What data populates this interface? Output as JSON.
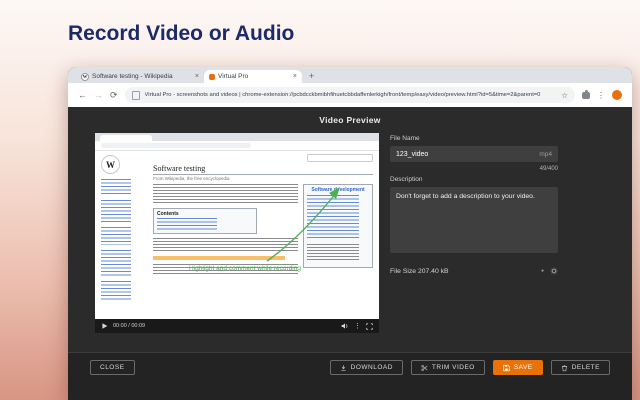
{
  "hero": {
    "title": "Record Video or Audio"
  },
  "browser": {
    "tab1": "Software testing - Wikipedia",
    "tab2": "Virtual Pro",
    "url": "Virtual Pro - screenshots and videos | chrome-extension://pcbdcckbmibhfihuetcbbdaffenlerkigh/front/temp/easy/video/preview.html?id=5&time=2&parent=0"
  },
  "preview": {
    "heading": "Video Preview",
    "annotation": "Highlight and comment while recording",
    "time": "00:00 / 00:09"
  },
  "wiki": {
    "logo_letter": "W",
    "title": "Software testing",
    "subtitle": "From Wikipedia, the free encyclopedia",
    "contents": "Contents",
    "infobox_title": "Software development"
  },
  "panel": {
    "file_name_label": "File Name",
    "file_name_value": "123_video",
    "file_ext": "mp4",
    "char_counter": "49/400",
    "description_label": "Description",
    "description_value": "Don't forget to add a description to your video.",
    "file_size": "File Size 207.40 kB"
  },
  "actions": {
    "close": "CLOSE",
    "download": "DOWNLOAD",
    "trim": "TRIM VIDEO",
    "save": "SAVE",
    "delete": "DELETE"
  },
  "icons": {
    "tab_close": "×",
    "new_tab": "+",
    "back": "←",
    "forward": "→",
    "reload": "⟳",
    "bookmark_star": "☆",
    "menu_kebab": "⋮",
    "overflow_kebab": "⋮",
    "status_dot": "●"
  }
}
